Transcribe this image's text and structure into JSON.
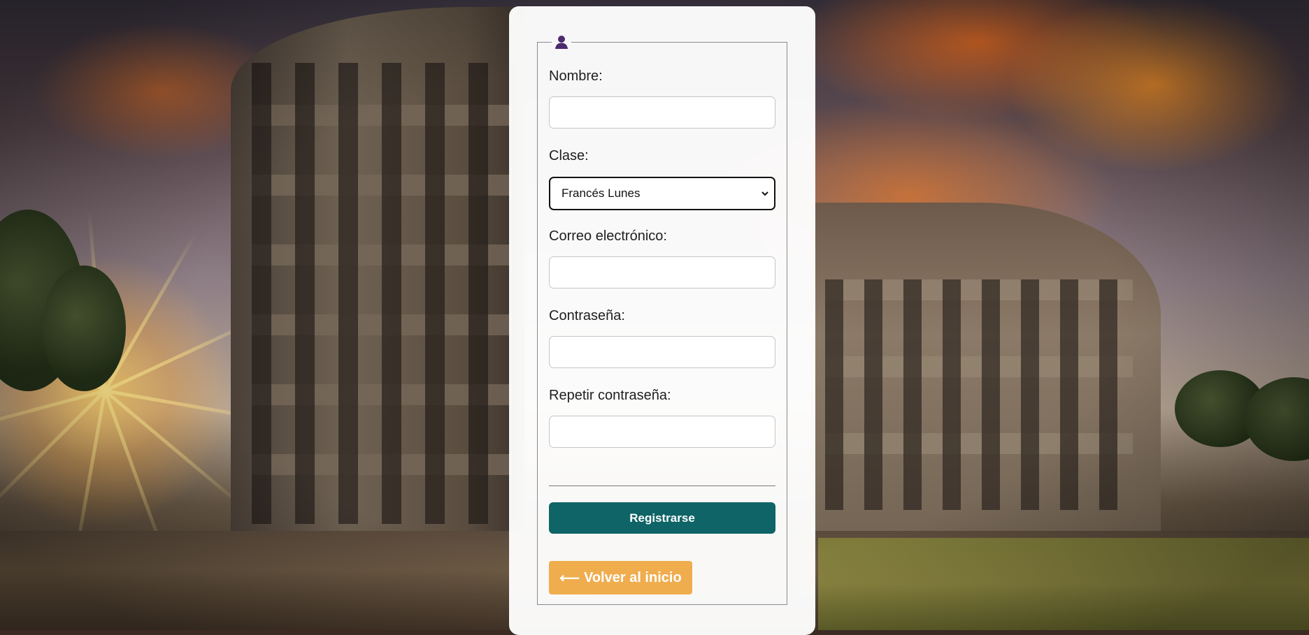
{
  "form": {
    "legend_icon": "user-icon",
    "fields": {
      "nombre": {
        "label": "Nombre:",
        "value": ""
      },
      "clase": {
        "label": "Clase:",
        "selected": "Francés Lunes"
      },
      "correo": {
        "label": "Correo electrónico:",
        "value": ""
      },
      "contrasena": {
        "label": "Contraseña:",
        "value": ""
      },
      "repetir": {
        "label": "Repetir contraseña:",
        "value": ""
      }
    },
    "submit_label": "Registrarse",
    "back_arrow": "⟵",
    "back_label": "Volver al inicio"
  },
  "colors": {
    "primary": "#0e6466",
    "warning": "#f0ad4e",
    "legend_icon": "#4b2a6e"
  }
}
